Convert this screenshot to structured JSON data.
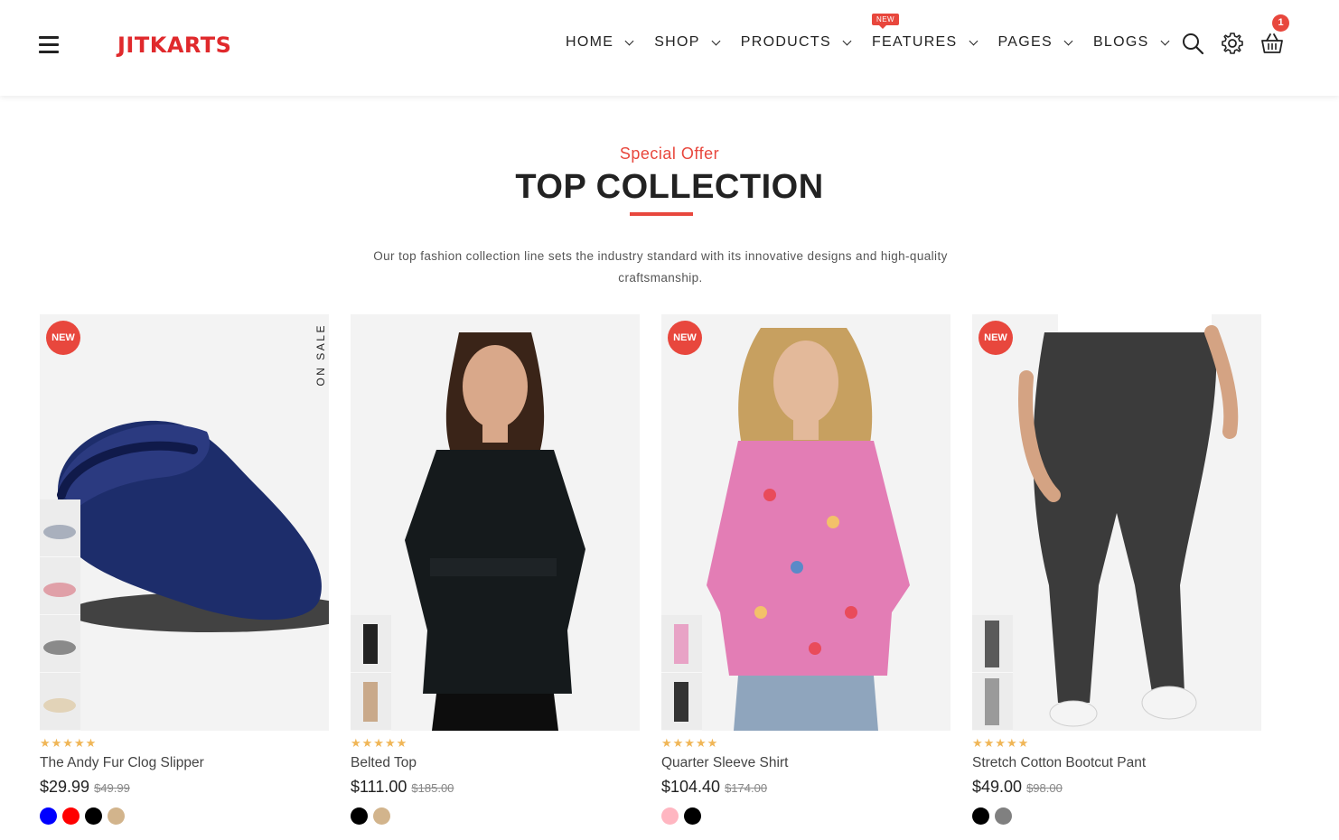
{
  "header": {
    "logo": "JITKARTS",
    "nav": [
      {
        "label": "HOME",
        "badge": ""
      },
      {
        "label": "SHOP",
        "badge": ""
      },
      {
        "label": "PRODUCTS",
        "badge": ""
      },
      {
        "label": "FEATURES",
        "badge": "NEW"
      },
      {
        "label": "PAGES",
        "badge": ""
      },
      {
        "label": "BLOGS",
        "badge": ""
      }
    ],
    "cart_count": "1",
    "icons": [
      "menu-icon",
      "search-icon",
      "gear-icon",
      "basket-icon"
    ]
  },
  "section": {
    "eyebrow": "Special Offer",
    "title": "TOP COLLECTION",
    "description": "Our top fashion collection line sets the industry standard with its innovative designs and high-quality craftsmanship."
  },
  "products": [
    {
      "name": "The Andy Fur Clog Slipper",
      "price": "$29.99",
      "old_price": "$49.99",
      "badge": "NEW",
      "side_label": "ON SALE",
      "stars": "★★★★★",
      "rating": 5,
      "swatches": [
        "#0000ff",
        "#ff0000",
        "#000000",
        "#d2b48c"
      ]
    },
    {
      "name": "Belted Top",
      "price": "$111.00",
      "old_price": "$185.00",
      "badge": "",
      "side_label": "",
      "stars": "★★★★★",
      "rating": 5,
      "swatches": [
        "#000000",
        "#d2b48c"
      ]
    },
    {
      "name": "Quarter Sleeve Shirt",
      "price": "$104.40",
      "old_price": "$174.00",
      "badge": "NEW",
      "side_label": "",
      "stars": "★★★★★",
      "rating": 5,
      "swatches": [
        "#ffb6c1",
        "#000000"
      ]
    },
    {
      "name": "Stretch Cotton Bootcut Pant",
      "price": "$49.00",
      "old_price": "$98.00",
      "badge": "NEW",
      "side_label": "",
      "stars": "★★★★★",
      "rating": 5,
      "swatches": [
        "#000000",
        "#808080"
      ]
    }
  ],
  "colors": {
    "brand_red": "#e0292c",
    "accent": "#e8473d",
    "star": "#f0b657"
  }
}
